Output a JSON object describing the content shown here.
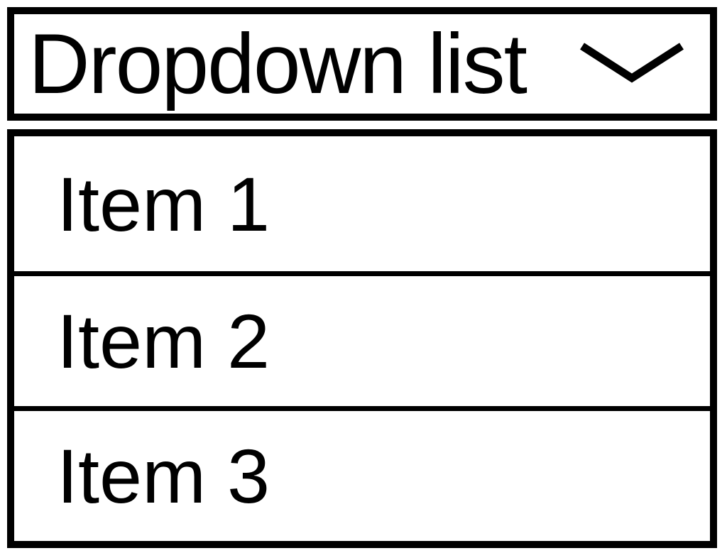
{
  "dropdown": {
    "label": "Dropdown list",
    "items": [
      {
        "label": "Item 1"
      },
      {
        "label": "Item 2"
      },
      {
        "label": "Item 3"
      }
    ]
  }
}
